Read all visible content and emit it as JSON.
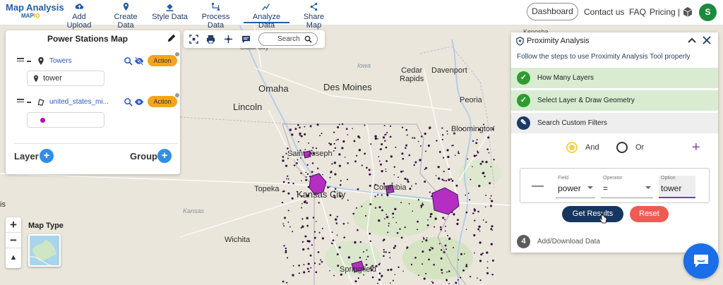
{
  "brand": {
    "title": "Map Analysis",
    "sub_prefix": "MAP",
    "sub_suffix": "IO"
  },
  "nav": [
    {
      "label": "Add Upload",
      "icon": "cloud-upload-icon"
    },
    {
      "label": "Create Data",
      "icon": "map-pin-icon"
    },
    {
      "label": "Style Data",
      "icon": "paint-bucket-icon"
    },
    {
      "label": "Process Data",
      "icon": "process-icon"
    },
    {
      "label": "Analyze Data",
      "icon": "analyze-icon",
      "active": true
    },
    {
      "label": "Share Map",
      "icon": "share-icon"
    }
  ],
  "header_right": {
    "dashboard": "Dashboard",
    "contact": "Contact us",
    "faq": "FAQ",
    "pricing": "Pricing |",
    "avatar_initial": "S"
  },
  "layer_panel": {
    "title": "Power Stations Map",
    "layers": [
      {
        "name": "Towers",
        "filter_value": "tower",
        "action_label": "Action",
        "visible": false
      },
      {
        "name": "united_states_mi...",
        "action_label": "Action",
        "visible": true,
        "swatch_color": "#b40fb0"
      }
    ],
    "footer": {
      "layer_label": "Layer",
      "group_label": "Group"
    }
  },
  "map_toolbar": {
    "search_placeholder": "Search"
  },
  "map_labels": {
    "kenosha": "Kenosha",
    "sioux_city": "Sioux City",
    "iowa": "Iowa",
    "cedar_rapids": "Cedar\nRapids",
    "omaha": "Omaha",
    "des_moines": "Des Moines",
    "davenport": "Davenport",
    "lincoln": "Lincoln",
    "peoria": "Peoria",
    "bloomington": "Bloomington",
    "saint_joseph": "Saint Joseph",
    "topeka": "Topeka",
    "kansas_city": "Kansas City",
    "columbia": "Columbia",
    "kansas": "Kansas",
    "wichita": "Wichita",
    "springfield": "Springfield",
    "is": "is"
  },
  "map_controls": {
    "zoom_in": "+",
    "zoom_out": "−",
    "north": "▲",
    "map_type_label": "Map Type"
  },
  "proximity_panel": {
    "title": "Proximity Analysis",
    "subtitle": "Follow the steps to use Proximity Analysis Tool properly",
    "steps": [
      {
        "label": "How Many Layers",
        "state": "done"
      },
      {
        "label": "Select Layer & Draw Geometry",
        "state": "done"
      },
      {
        "label": "Search Custom Filters",
        "state": "current"
      },
      {
        "label": "Add/Download Data",
        "state": "pending",
        "number": "4"
      }
    ],
    "logic": {
      "and_label": "And",
      "or_label": "Or",
      "selected": "And"
    },
    "filter": {
      "field_label": "Field",
      "field_value": "power",
      "operator_label": "Operator",
      "operator_value": "=",
      "option_label": "Option",
      "option_value": "tower"
    },
    "get_results_label": "Get Results",
    "reset_label": "Reset"
  },
  "colors": {
    "brand_blue": "#1e5fa8",
    "accent_orange": "#f4a51c",
    "dark_navy": "#17365f",
    "reset_red": "#f05a55",
    "done_green": "#2f9c2f",
    "point_purple": "#b40fb0"
  }
}
